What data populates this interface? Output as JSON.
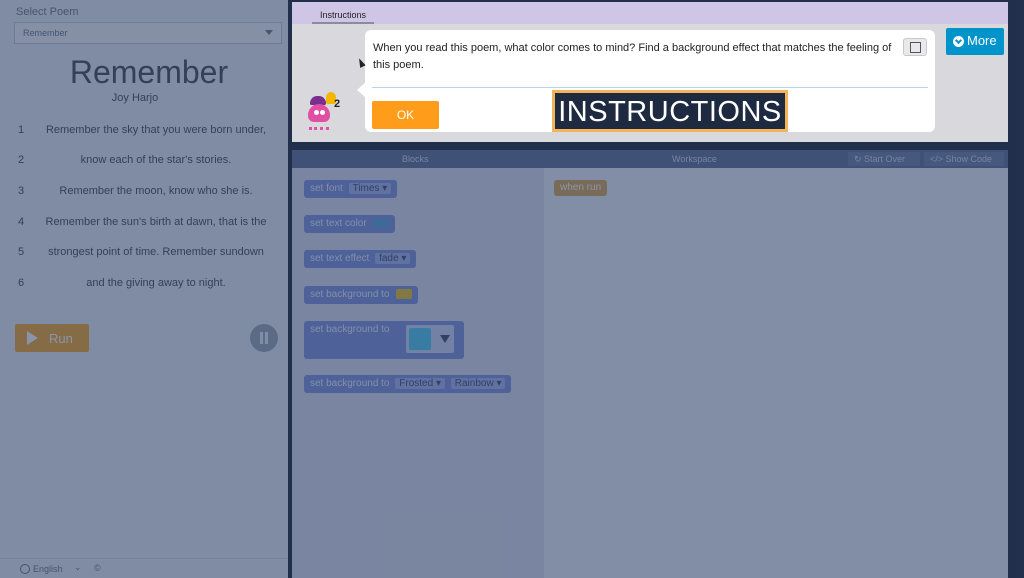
{
  "left_panel": {
    "select_label": "Select Poem",
    "selected_poem": "Remember",
    "title": "Remember",
    "author": "Joy Harjo",
    "lines": [
      {
        "num": "1",
        "text": "Remember the sky that you were born under,"
      },
      {
        "num": "2",
        "text": "know each of the star's stories."
      },
      {
        "num": "3",
        "text": "Remember the moon, know who she is."
      },
      {
        "num": "4",
        "text": "Remember the sun's birth at dawn, that is the"
      },
      {
        "num": "5",
        "text": "strongest point of time. Remember sundown"
      },
      {
        "num": "6",
        "text": "and the giving away to night."
      }
    ],
    "run_label": "Run",
    "language": "English",
    "copyright": "©"
  },
  "workspace": {
    "blocks_header": "Blocks",
    "workspace_header": "Workspace",
    "start_over": "Start Over",
    "show_code": "Show Code",
    "blocks": {
      "set_font": "set font",
      "font_value": "Times ▾",
      "set_text_color": "set text color",
      "set_text_effect": "set text effect",
      "effect_value": "fade ▾",
      "set_background": "set background to",
      "set_background_effect": "set background to",
      "set_background_to": "set background to",
      "bg_value1": "Frosted ▾",
      "bg_value2": "Rainbow ▾"
    },
    "when_run": "when run"
  },
  "instructions": {
    "tab_label": "Instructions",
    "message": "When you read this poem, what color comes to mind? Find a background effect that matches the feeling of this poem.",
    "ok_label": "OK",
    "more_label": "More",
    "hint_count": "2"
  },
  "caption": "INSTRUCTIONS",
  "colors": {
    "accent_orange": "#ff9c1a",
    "more_blue": "#0094ca",
    "block_purple": "#7c8fd9",
    "event_gold": "#d9a44a"
  }
}
